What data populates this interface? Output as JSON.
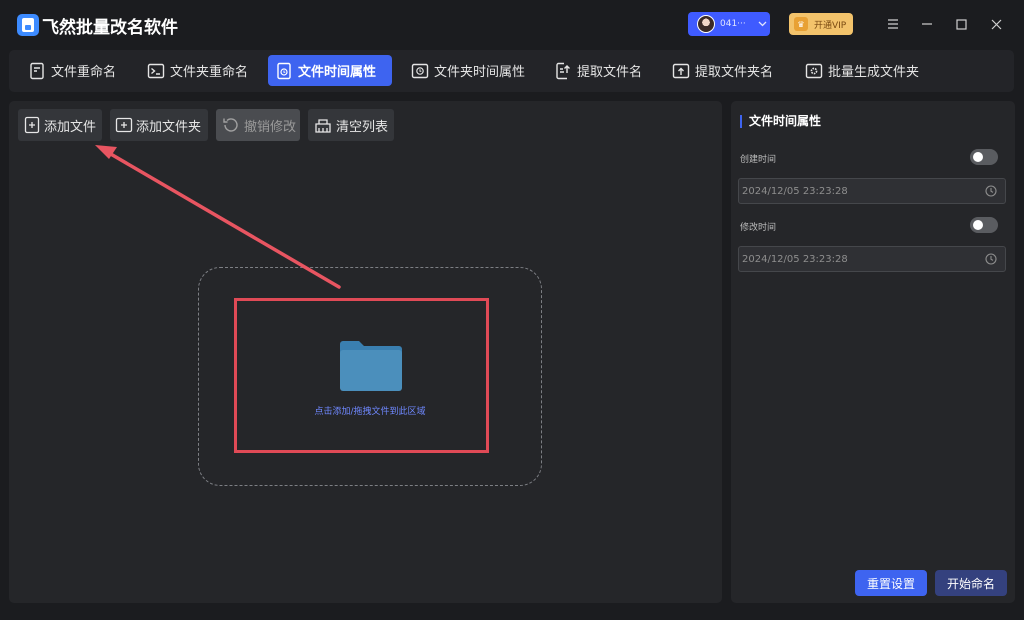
{
  "app": {
    "title": "飞然批量改名软件"
  },
  "user": {
    "name": "041···"
  },
  "vip": {
    "label": "开通VIP"
  },
  "tabs": [
    {
      "label": "文件重命名"
    },
    {
      "label": "文件夹重命名"
    },
    {
      "label": "文件时间属性"
    },
    {
      "label": "文件夹时间属性"
    },
    {
      "label": "提取文件名"
    },
    {
      "label": "提取文件夹名"
    },
    {
      "label": "批量生成文件夹"
    }
  ],
  "toolbar": {
    "add_file": "添加文件",
    "add_folder": "添加文件夹",
    "undo": "撤销修改",
    "clear": "清空列表"
  },
  "dropzone": {
    "text": "点击添加/拖拽文件到此区域"
  },
  "side": {
    "title": "文件时间属性",
    "created_label": "创建时间",
    "created_value": "2024/12/05 23:23:28",
    "modified_label": "修改时间",
    "modified_value": "2024/12/05 23:23:28",
    "reset": "重置设置",
    "start": "开始命名"
  },
  "colors": {
    "accent": "#3e64f0",
    "highlight": "#e04a56",
    "vip": "#f3c36b"
  }
}
